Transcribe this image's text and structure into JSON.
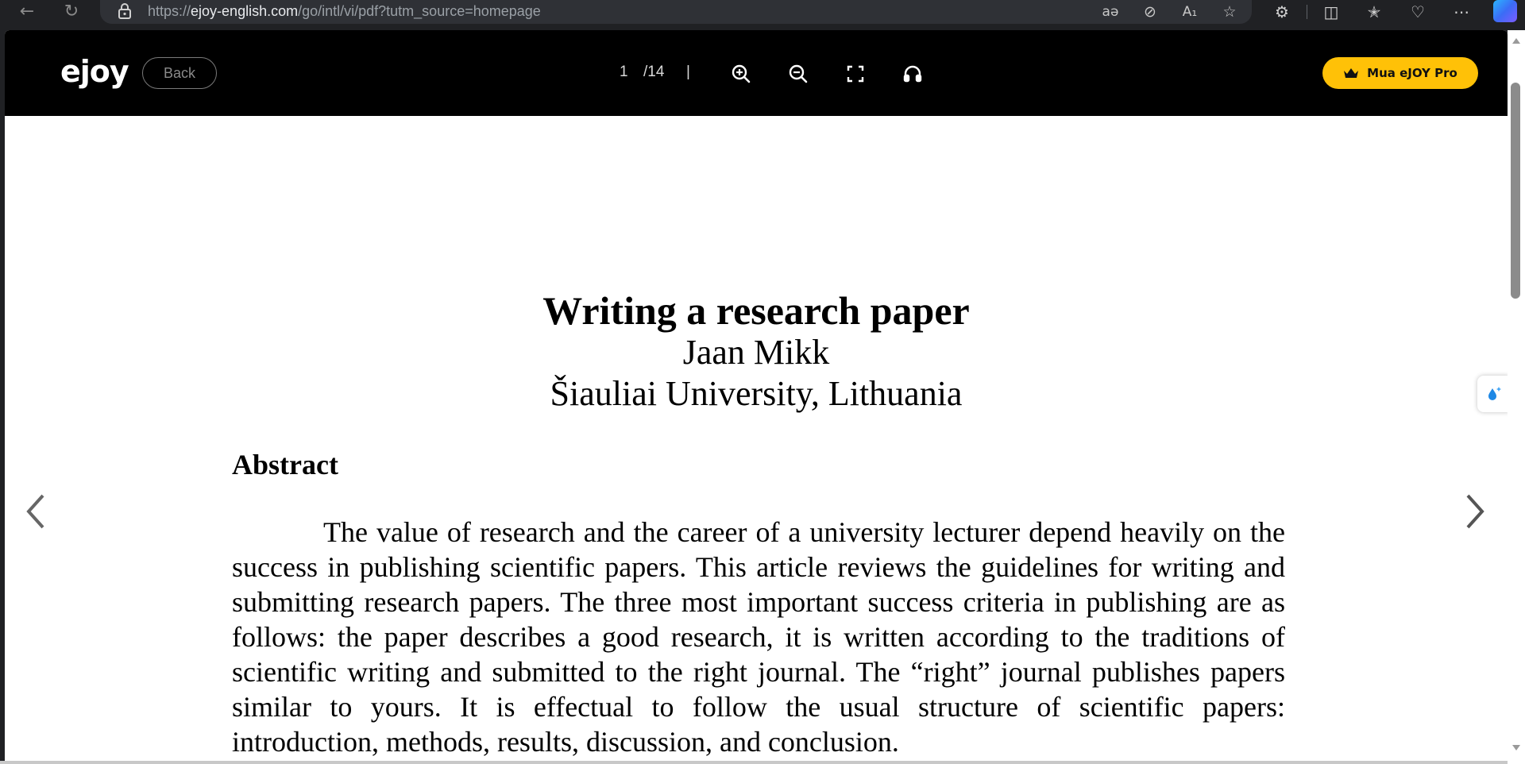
{
  "browser": {
    "url_prefix": "https://",
    "url_host": "ejoy-english.com",
    "url_path": "/go/intl/vi/pdf?tutm_source=homepage"
  },
  "app": {
    "logo": "ejoy",
    "back_label": "Back",
    "page_current": "1",
    "page_total": "/14",
    "page_sep": "|",
    "pro_label": "Mua eJOY Pro",
    "accent_color": "#ffc107"
  },
  "document": {
    "title": "Writing a research paper",
    "author": "Jaan Mikk",
    "affiliation": "Šiauliai University, Lithuania",
    "abstract_heading": "Abstract",
    "abstract_text": "The value of research and the career of a university lecturer depend heavily on the success in publishing scientific papers. This article reviews the guidelines for writing and submitting research papers. The three most important success criteria in publishing are as follows: the paper describes a good research, it is written according to the traditions of scientific writing and submitted to the right journal. The “right” journal publishes papers similar to yours. It is effectual to follow the usual structure of scientific papers: introduction, methods, results, discussion, and conclusion."
  }
}
